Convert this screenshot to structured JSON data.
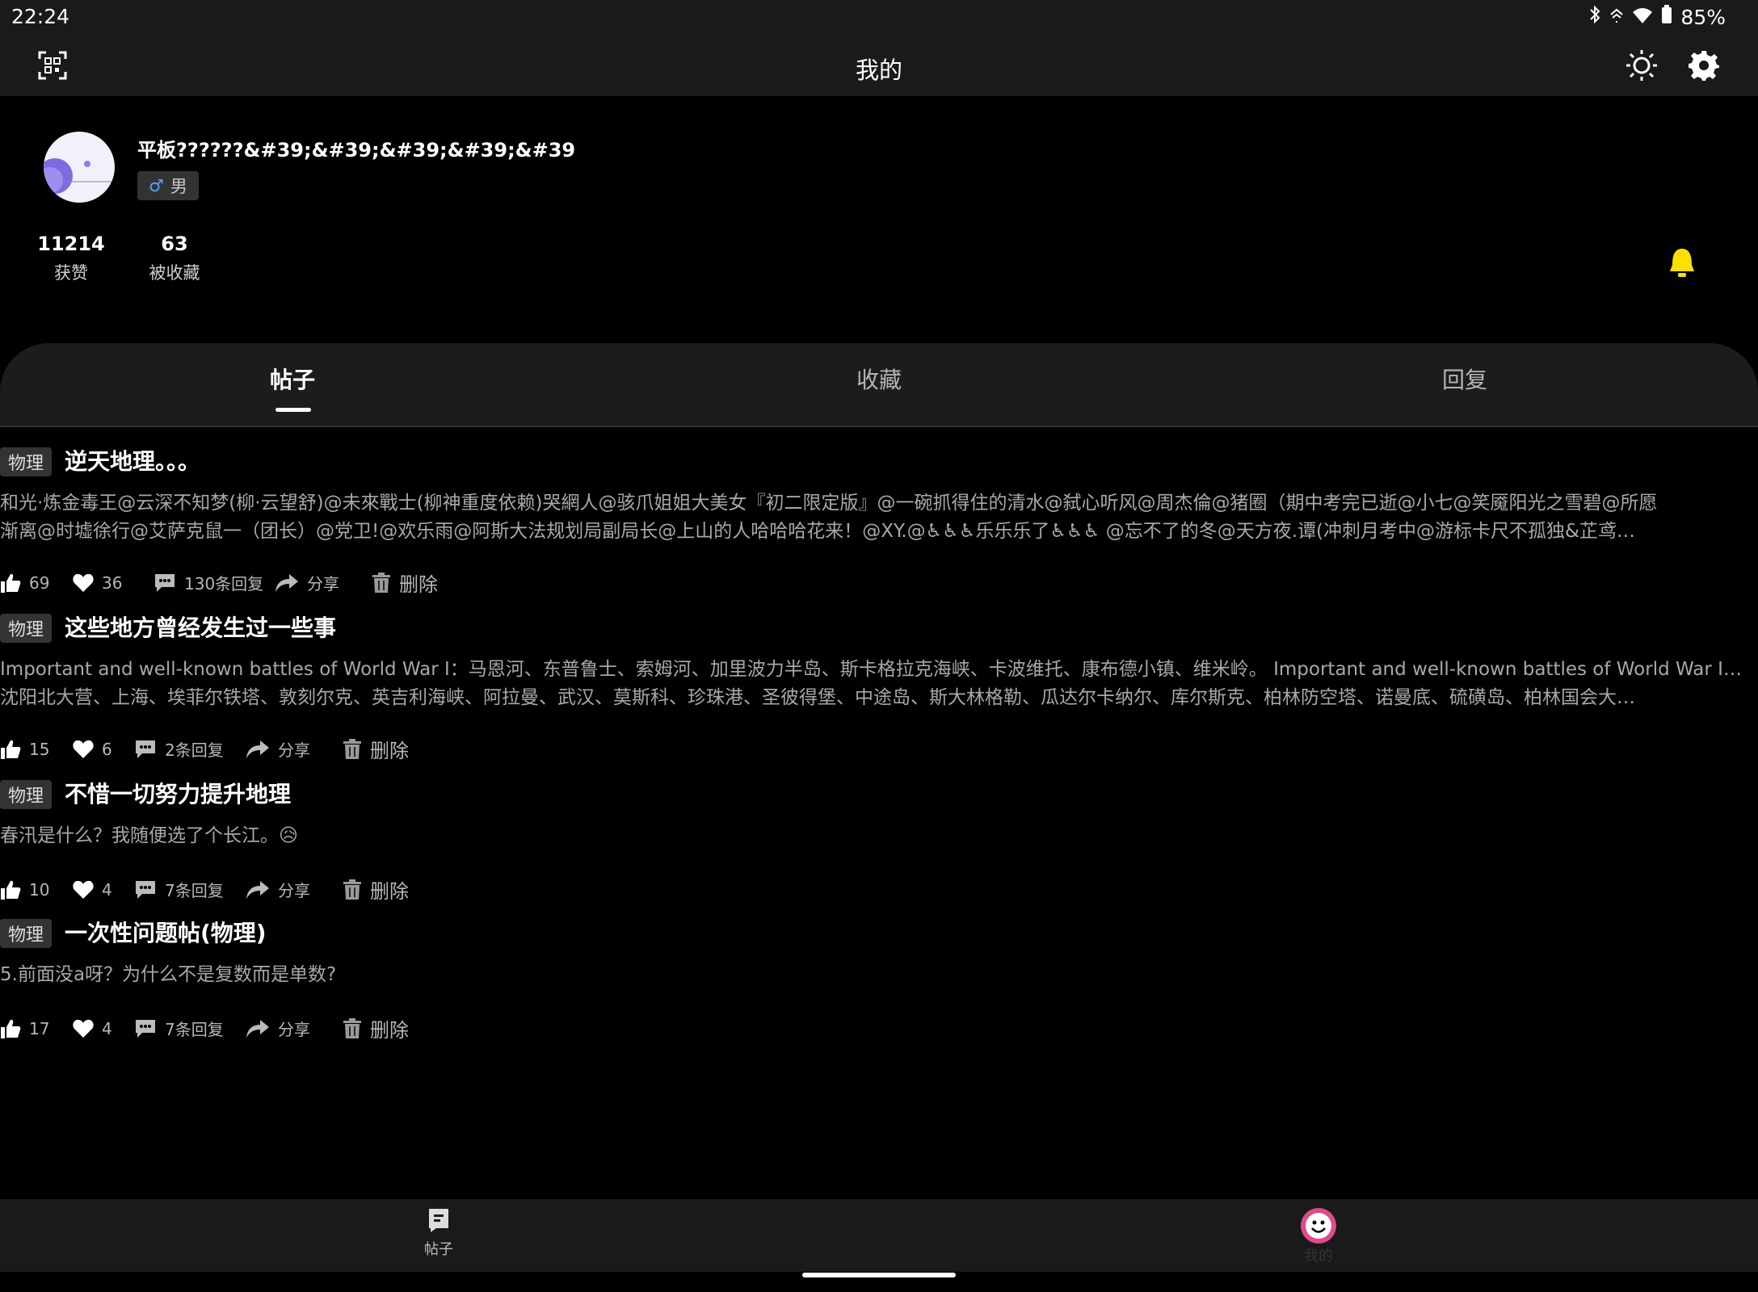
{
  "status_bar": {
    "time": "22:24",
    "battery": "85%"
  },
  "header": {
    "title": "我的"
  },
  "profile": {
    "username": "平板??????&#39;&#39;&#39;&#39;&#39",
    "gender_symbol": "♂",
    "gender": "男",
    "stats": [
      {
        "value": "11214",
        "label": "获赞"
      },
      {
        "value": "63",
        "label": "被收藏"
      }
    ]
  },
  "tabs": [
    {
      "label": "帖子",
      "active": true
    },
    {
      "label": "收藏",
      "active": false
    },
    {
      "label": "回复",
      "active": false
    }
  ],
  "posts": [
    {
      "tag": "物理",
      "title": "逆天地理。。。",
      "body_lines": [
        "和光·炼金毒王@云深不知梦(柳·云望舒)@未來戰士(柳神重度依赖)哭網人@骇爪姐姐大美女『初二限定版』@一碗抓得住的清水@弑心听风@周杰倫@猪圈（期中考完已逝@小七@笑魇阳光之雪碧@所愿",
        "渐离@时墟徐行@艾萨克鼠一（团长）@党卫!@欢乐雨@阿斯大法规划局副局长@上山的人哈哈哈花来！@XY.@♿♿♿乐乐乐了♿♿♿ @忘不了的冬@天方夜.谭(冲刺月考中@游标卡尺不孤独&芷鸢…"
      ],
      "likes": "69",
      "favorites": "36",
      "replies": "130条回复",
      "share": "分享",
      "delete": "删除"
    },
    {
      "tag": "物理",
      "title": "这些地方曾经发生过一些事",
      "body_lines": [
        "Important and well-known battles of World War I：马恩河、东普鲁士、索姆河、加里波力半岛、斯卡格拉克海峡、卡波维托、康布德小镇、维米岭。 Important and well-known battles of World War II ：",
        "沈阳北大营、上海、埃菲尔铁塔、敦刻尔克、英吉利海峡、阿拉曼、武汉、莫斯科、珍珠港、圣彼得堡、中途岛、斯大林格勒、瓜达尔卡纳尔、库尔斯克、柏林防空塔、诺曼底、硫磺岛、柏林国会大…"
      ],
      "likes": "15",
      "favorites": "6",
      "replies": "2条回复",
      "share": "分享",
      "delete": "删除"
    },
    {
      "tag": "物理",
      "title": "不惜一切努力提升地理",
      "body_lines": [
        "春汛是什么？我随便选了个长江。😥"
      ],
      "likes": "10",
      "favorites": "4",
      "replies": "7条回复",
      "share": "分享",
      "delete": "删除"
    },
    {
      "tag": "物理",
      "title": "一次性问题帖(物理)",
      "body_lines": [
        "5.前面没a呀？为什么不是复数而是单数?"
      ],
      "likes": "17",
      "favorites": "4",
      "replies": "7条回复",
      "share": "分享",
      "delete": "删除"
    }
  ],
  "bottom_nav": [
    {
      "label": "帖子",
      "icon": "post-icon"
    },
    {
      "label": "我的",
      "icon": "smiley-icon"
    }
  ],
  "colors": {
    "bell": "#ffe000",
    "accent_pink": "#e04a8c"
  }
}
